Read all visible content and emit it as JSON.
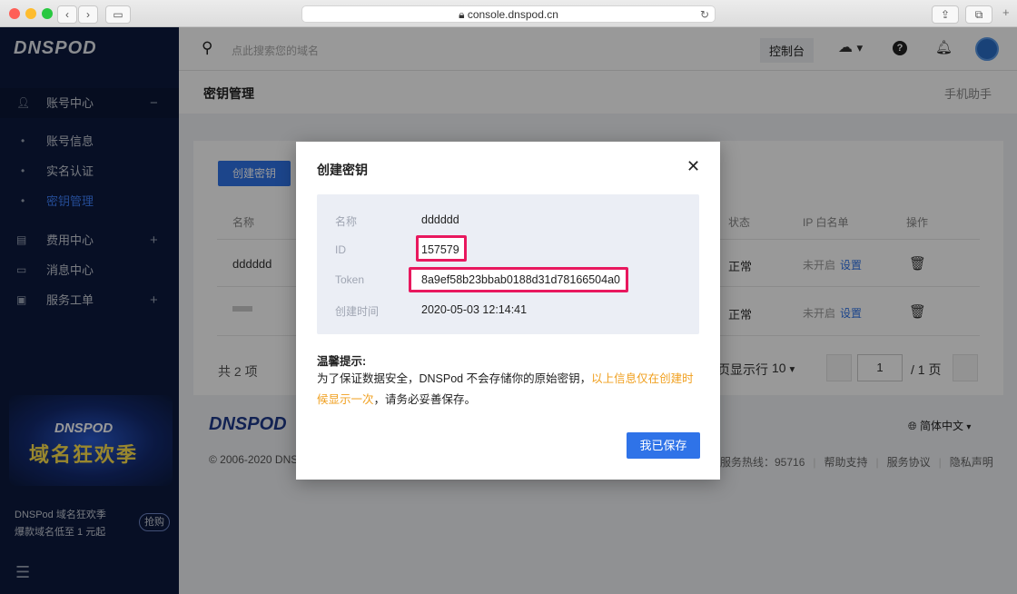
{
  "browser": {
    "url": "console.dnspod.cn"
  },
  "sidebar": {
    "logo": "DNSPOD",
    "items": [
      {
        "label": "账号中心",
        "toggle": "−"
      },
      {
        "label": "账号信息"
      },
      {
        "label": "实名认证"
      },
      {
        "label": "密钥管理"
      },
      {
        "label": "费用中心",
        "toggle": "+"
      },
      {
        "label": "消息中心"
      },
      {
        "label": "服务工单",
        "toggle": "+"
      }
    ],
    "promo": {
      "brand": "DNSPOD",
      "title": "域名狂欢季",
      "line1": "DNSPod 域名狂欢季",
      "line2": "爆款域名低至 1 元起",
      "button": "抢购"
    }
  },
  "header": {
    "search_placeholder": "点此搜索您的域名",
    "console": "控制台",
    "page_title": "密钥管理",
    "mobile_helper": "手机助手"
  },
  "main": {
    "create_button": "创建密钥",
    "columns": [
      "名称",
      "状态",
      "IP 白名单",
      "操作"
    ],
    "rows": [
      {
        "name": "dddddd",
        "status": "正常",
        "ip": "未开启",
        "set": "设置"
      },
      {
        "name": "",
        "status": "正常",
        "ip": "未开启",
        "set": "设置"
      }
    ],
    "total": "共 2 项",
    "per_page_label": "页显示行",
    "per_page": "10",
    "page": "1",
    "page_total": "/ 1 页"
  },
  "footer": {
    "logo": "DNSPOD",
    "copyright": "© 2006-2020 DNS",
    "language": "简体中文",
    "hotline": "服务热线：95716",
    "links": [
      "帮助支持",
      "服务协议",
      "隐私声明"
    ]
  },
  "modal": {
    "title": "创建密钥",
    "fields": [
      {
        "key": "名称",
        "value": "dddddd"
      },
      {
        "key": "ID",
        "value": "157579"
      },
      {
        "key": "Token",
        "value": "8a9ef58b23bbab0188d31d78166504a0"
      },
      {
        "key": "创建时间",
        "value": "2020-05-03 12:14:41"
      }
    ],
    "tip_title": "温馨提示:",
    "tip_text": "为了保证数据安全，DNSPod 不会存储你的原始密钥，",
    "tip_highlight": "以上信息仅在创建时候显示一次",
    "tip_end": "，请务必妥善保存。",
    "confirm": "我已保存"
  },
  "colors": {
    "primary": "#2f73e8",
    "highlight": "#e8185e",
    "warning": "#f0a020"
  }
}
